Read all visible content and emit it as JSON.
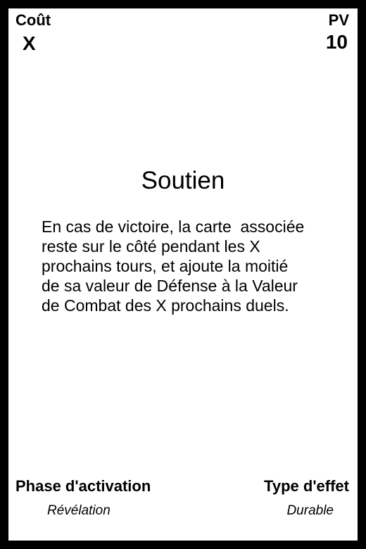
{
  "card": {
    "cost_label": "Coût",
    "cost_value": "X",
    "hp_label": "PV",
    "hp_value": "10",
    "title": "Soutien",
    "description": "En cas de victoire, la carte  associée\nreste sur le côté pendant les X\nprochains tours, et ajoute la moitié\nde sa valeur de Défense à la Valeur\nde Combat des X prochains duels.",
    "phase_label": "Phase d'activation",
    "phase_value": "Révélation",
    "effect_type_label": "Type d'effet",
    "effect_type_value": "Durable"
  },
  "colors": {
    "border": "#000000",
    "background": "#ffffff",
    "text": "#000000"
  }
}
